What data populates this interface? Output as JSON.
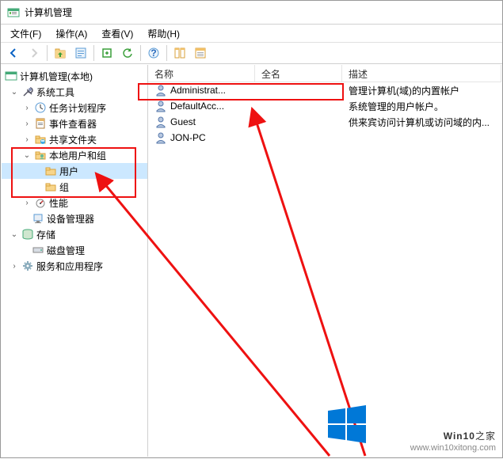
{
  "window": {
    "title": "计算机管理"
  },
  "menu": {
    "file": "文件(F)",
    "action": "操作(A)",
    "view": "查看(V)",
    "help": "帮助(H)"
  },
  "tree": {
    "root": "计算机管理(本地)",
    "system_tools": "系统工具",
    "task_scheduler": "任务计划程序",
    "event_viewer": "事件查看器",
    "shared_folders": "共享文件夹",
    "local_users_groups": "本地用户和组",
    "users": "用户",
    "groups": "组",
    "performance": "性能",
    "device_manager": "设备管理器",
    "storage": "存储",
    "disk_management": "磁盘管理",
    "services_apps": "服务和应用程序"
  },
  "columns": {
    "name": "名称",
    "fullname": "全名",
    "desc": "描述"
  },
  "users": [
    {
      "name": "Administrat...",
      "fullname": "",
      "desc": "管理计算机(域)的内置帐户"
    },
    {
      "name": "DefaultAcc...",
      "fullname": "",
      "desc": "系统管理的用户帐户。"
    },
    {
      "name": "Guest",
      "fullname": "",
      "desc": "供来宾访问计算机或访问域的内..."
    },
    {
      "name": "JON-PC",
      "fullname": "",
      "desc": ""
    }
  ],
  "watermark": {
    "brand_a": "Win10",
    "brand_b": "之家",
    "url": "www.win10xitong.com"
  }
}
